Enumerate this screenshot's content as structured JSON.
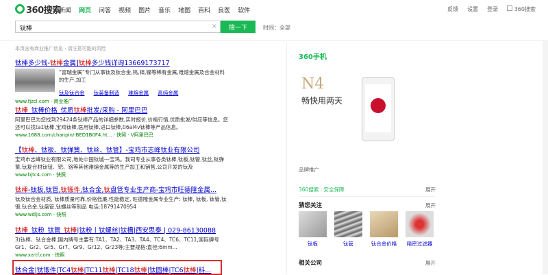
{
  "header": {
    "logo_text": "360搜索",
    "nav": [
      "新闻",
      "网页",
      "问答",
      "视频",
      "图片",
      "音乐",
      "地图",
      "百科",
      "良医",
      "软件"
    ],
    "active_nav": "网页",
    "right_links": [
      "反馈",
      "设置",
      "登录"
    ],
    "user_label": "360搜索"
  },
  "search": {
    "query": "钛棒",
    "clear_icon": "×",
    "button": "搜一下",
    "time_filter": "时间：全部"
  },
  "notice": "本页含有商业推广信息 · 请注意可能的风险",
  "results": [
    {
      "title_parts": [
        [
          "钛棒",
          1
        ],
        [
          "多少钱-",
          0
        ],
        [
          "钛棒",
          1
        ],
        [
          "金属]",
          0
        ],
        [
          "钛棒",
          1
        ],
        [
          "多少钱详询13669173717",
          0
        ]
      ],
      "desc": "“富瑞金属”专门从事钛及钛合金,钨,钼,镍等稀有金属,难熔金属及合金材料的生产,加工",
      "subs": [
        "钛及钛合金",
        "钛装备制造",
        "难熔金属",
        "高纯金属"
      ],
      "url": "www.fjzcl.com · 商业推广"
    },
    {
      "title_parts": [
        [
          "钛棒",
          1
        ],
        [
          "_钛棒价格_优质",
          0
        ],
        [
          "钛棒",
          1
        ],
        [
          "批发/采购 - 阿里巴巴",
          0
        ]
      ],
      "desc": "阿里巴巴为您找到29424条钛棒产品的详细参数,实时报价,价格行情,优质批发/供应等信息。您还可以找ta1钛棒,宝鸡钛棒,医用钛棒,进口钛棒,ti6al4v钛棒等产品信息。",
      "url": "www.1688.com/chanpin/-BED1B0F4.ht... · 快照 · V阿里巴巴"
    },
    {
      "title_parts": [
        [
          "【",
          0
        ],
        [
          "钛棒",
          1
        ],
        [
          "、钛板、钛弹簧、钛丝、钛管】-宝鸡市志峰钛业有限公司",
          0
        ]
      ],
      "desc": "宝鸡市志峰钛业有限公司,地处中国钛城---宝鸡。我司专业从事各类钛棒,钛板,钛管,钛丝,钛弹簧,钛复合材钛钮、钯、铬等其他难熔金属等的生产加工和销售,公司开发的钛及",
      "url": "www.bjtc4.com · 快照"
    },
    {
      "title_parts": [
        [
          "钛棒",
          1
        ],
        [
          "-钛板,钛管,",
          0
        ],
        [
          "钛锻件",
          1
        ],
        [
          ",钛合金,",
          0
        ],
        [
          "钛",
          1
        ],
        [
          "盘管专业生产商-宝鸡市旺德隆金属...",
          0
        ]
      ],
      "desc": "钛及钛合金材质, 钛棒质量可靠,价格低廉,性能稳定, 旺德隆金属专业生产: 钛棒, 钛板, 钛管,钛锻,钛合金,钛盘管,钛螺丝等制品 电话:18791470954",
      "url": "www.wdljs.com · 快照"
    },
    {
      "title_parts": [
        [
          "钛棒",
          1
        ],
        [
          "_钛粉_钛管_",
          0
        ],
        [
          "钛棒",
          1
        ],
        [
          "|钛粉丨钛螺丝|钛槽|西安思泰 | 029-86130088",
          0
        ]
      ],
      "desc": "3)钛棒、钛合金棒,国内牌号主要有:TA1、TA2、TA3、TA4、TC4、TC6、TC11,国际牌号 Gr1、Gr2、Gr5、Gr7、Gr9、Gr12、Gr23等;主要规格:直径:6mm...",
      "url": "www.xa-tf.com · 快照"
    },
    {
      "title_parts": [
        [
          "钛合金|钛锻件|TC4",
          0
        ],
        [
          "钛棒",
          1
        ],
        [
          "|TC11",
          0
        ],
        [
          "钛棒",
          1
        ],
        [
          "|TC18",
          0
        ],
        [
          "钛棒",
          1
        ],
        [
          "|钛圆棒|TC6",
          0
        ],
        [
          "钛棒",
          1
        ],
        [
          "|料...",
          0
        ]
      ],
      "desc": "",
      "url": ""
    }
  ],
  "ad": {
    "logo": "360手机",
    "model": "N4",
    "slogan": "畅快用两天",
    "label": "品牌推广"
  },
  "safety": "360搜索 · 安全保障",
  "expand_label": "展开",
  "rec": {
    "title": "猜您关注",
    "items": [
      {
        "label": "钛板"
      },
      {
        "label": "钛管"
      },
      {
        "label": "钛合金价格"
      },
      {
        "label": "精密过滤器"
      }
    ]
  },
  "related": {
    "title": "相关公司"
  }
}
